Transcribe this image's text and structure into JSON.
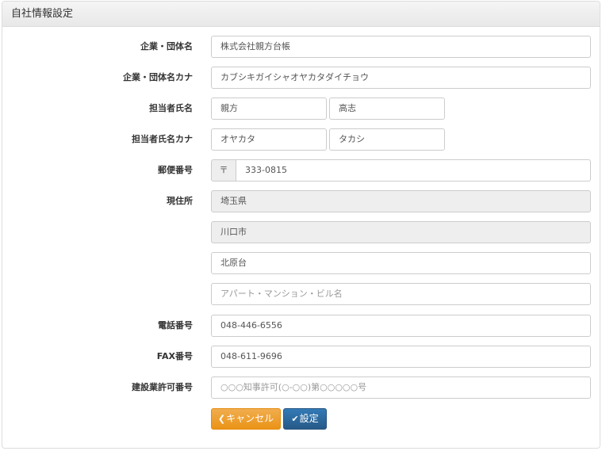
{
  "panel": {
    "title": "自社情報設定"
  },
  "form": {
    "company_name": {
      "label": "企業・団体名",
      "value": "株式会社親方台帳"
    },
    "company_kana": {
      "label": "企業・団体名カナ",
      "value": "カブシキガイシャオヤカタダイチョウ"
    },
    "person_name": {
      "label": "担当者氏名",
      "last": "親方",
      "first": "高志"
    },
    "person_kana": {
      "label": "担当者氏名カナ",
      "last": "オヤカタ",
      "first": "タカシ"
    },
    "postal": {
      "label": "郵便番号",
      "prefix": "〒",
      "value": "333-0815"
    },
    "address": {
      "label": "現住所",
      "prefecture": "埼玉県",
      "city": "川口市",
      "street": "北原台",
      "building_placeholder": "アパート・マンション・ビル名"
    },
    "phone": {
      "label": "電話番号",
      "value": "048-446-6556"
    },
    "fax": {
      "label": "FAX番号",
      "value": "048-611-9696"
    },
    "license": {
      "label": "建設業許可番号",
      "placeholder": "○○○知事許可(○-○○)第○○○○○号"
    }
  },
  "buttons": {
    "cancel": {
      "icon": "chevron-left-icon",
      "glyph": "❮",
      "label": "キャンセル"
    },
    "submit": {
      "icon": "check-icon",
      "glyph": "✔",
      "label": "設定"
    }
  }
}
